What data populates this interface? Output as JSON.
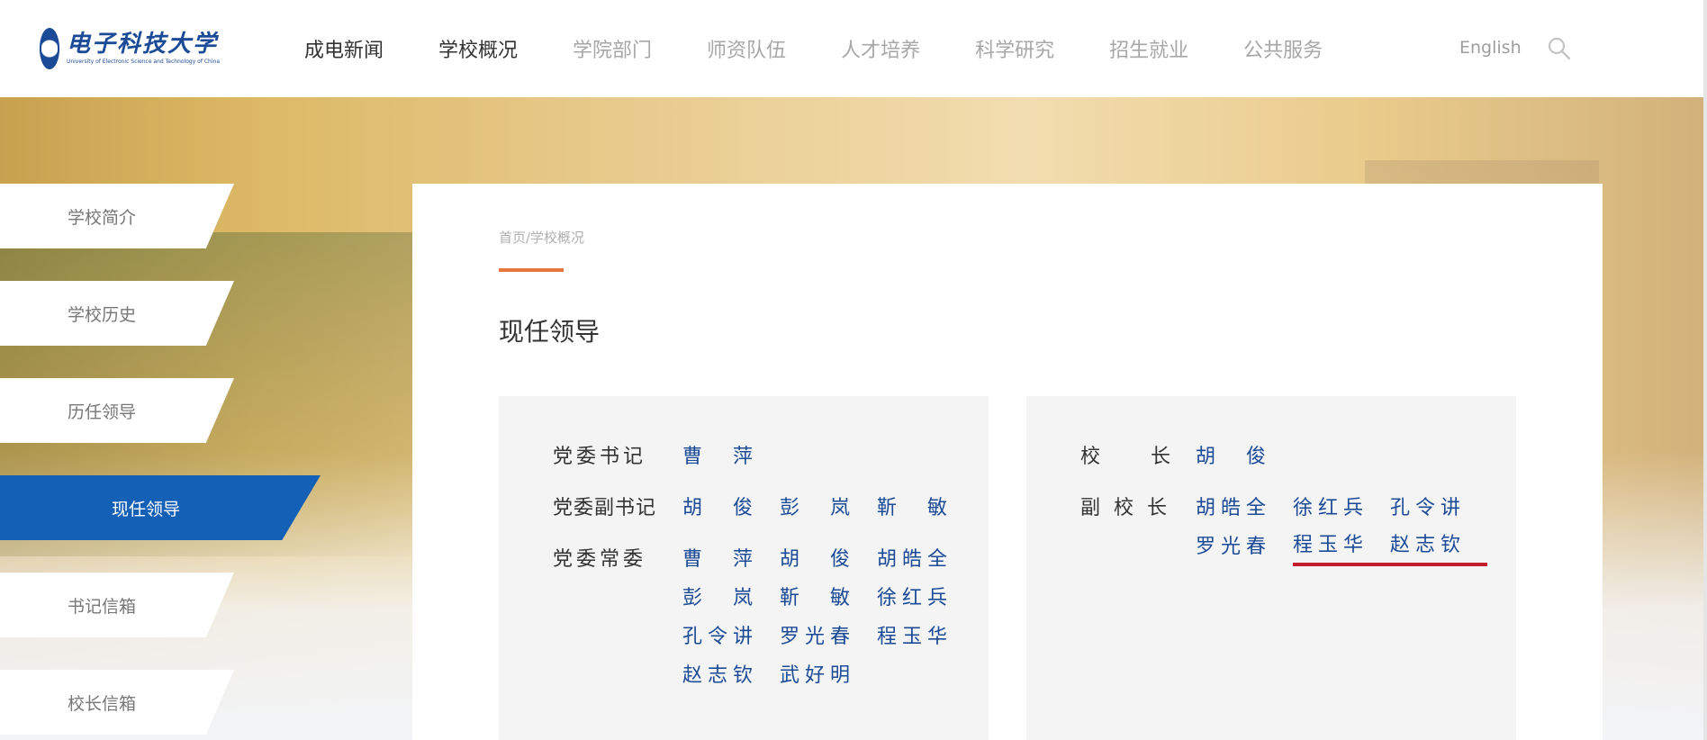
{
  "logo": {
    "cn": "电子科技大学",
    "en": "University of Electronic Science and Technology of China"
  },
  "nav": [
    "成电新闻",
    "学校概况",
    "学院部门",
    "师资队伍",
    "人才培养",
    "科学研究",
    "招生就业",
    "公共服务"
  ],
  "header": {
    "english": "English"
  },
  "sidebar": [
    "学校简介",
    "学校历史",
    "历任领导",
    "现任领导",
    "书记信箱",
    "校长信箱"
  ],
  "breadcrumb": "首页/学校概况",
  "page_title": "现任领导",
  "left_panel": {
    "rows": [
      {
        "label": "党委书记",
        "names": [
          "曹　萍"
        ]
      },
      {
        "label": "党委副书记",
        "names": [
          "胡　俊",
          "彭　岚",
          "靳　敏"
        ]
      },
      {
        "label": "党委常委",
        "names": [
          "曹　萍",
          "胡　俊",
          "胡皓全",
          "彭　岚",
          "靳　敏",
          "徐红兵",
          "孔令讲",
          "罗光春",
          "程玉华",
          "赵志钦",
          "武好明"
        ]
      }
    ]
  },
  "right_panel": {
    "rows": [
      {
        "label": "校　　长",
        "names": [
          "胡　俊"
        ]
      },
      {
        "label": "副 校 长",
        "names": [
          "胡皓全",
          "徐红兵",
          "孔令讲",
          "罗光春",
          "程玉华",
          "赵志钦"
        ]
      }
    ]
  },
  "colors": {
    "accent": "#1560b7",
    "name": "#1b4a96",
    "breadcrumb_bar": "#e8773c",
    "underline": "#c41e2c"
  }
}
